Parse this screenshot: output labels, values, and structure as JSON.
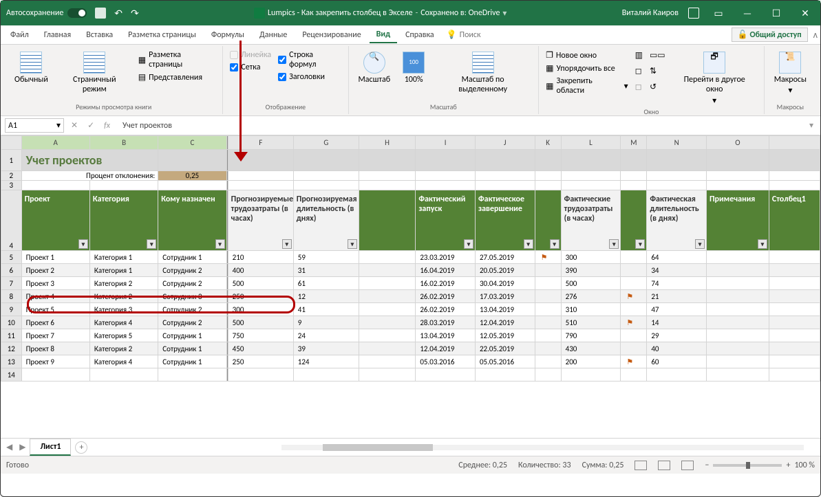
{
  "titlebar": {
    "autosave": "Автосохранение",
    "doc_title": "Lumpics - Как закрепить столбец в Экселе",
    "saved_in": "Сохранено в: OneDrive",
    "user": "Виталий Каиров"
  },
  "tabs": {
    "file": "Файл",
    "home": "Главная",
    "insert": "Вставка",
    "pagelayout": "Разметка страницы",
    "formulas": "Формулы",
    "data": "Данные",
    "review": "Рецензирование",
    "view": "Вид",
    "help": "Справка",
    "search": "Поиск",
    "share": "Общий доступ"
  },
  "ribbon": {
    "modes": {
      "normal": "Обычный",
      "page": "Страничный режим",
      "group_label": "Режимы просмотра книги",
      "pagelayout_btn": "Разметка страницы",
      "views_btn": "Представления"
    },
    "show": {
      "ruler": "Линейка",
      "formulabar": "Строка формул",
      "grid": "Сетка",
      "headings": "Заголовки",
      "group_label": "Отображение"
    },
    "zoom": {
      "zoom": "Масштаб",
      "hundred": "100%",
      "to_sel": "Масштаб по выделенному",
      "group_label": "Масштаб"
    },
    "window": {
      "new": "Новое окно",
      "arrange": "Упорядочить все",
      "freeze": "Закрепить области",
      "switch": "Перейти в другое окно",
      "group_label": "Окно"
    },
    "macros": {
      "label": "Макросы",
      "group_label": "Макросы"
    }
  },
  "formulabar": {
    "namebox": "A1",
    "fx": "fx",
    "value": "Учет проектов"
  },
  "cols": [
    "A",
    "B",
    "C",
    "F",
    "G",
    "H",
    "I",
    "J",
    "K",
    "L",
    "M",
    "N",
    "O"
  ],
  "title_row": "Учет проектов",
  "pct_label": "Процент отклонения:",
  "pct_val": "0,25",
  "headers": {
    "proj": "Проект",
    "cat": "Категория",
    "assignee": "Кому назначен",
    "est_hours": "Прогнозируемые трудозатраты (в часах)",
    "est_days": "Прогнозируемая длительность (в днях)",
    "actual_start": "Фактический запуск",
    "actual_end": "Фактическое завершение",
    "actual_hours": "Фактические трудозатраты (в часах)",
    "actual_days": "Фактическая длительность (в днях)",
    "notes": "Примечания",
    "col1": "Столбец1"
  },
  "rows": [
    {
      "proj": "Проект 1",
      "cat": "Категория 1",
      "assignee": "Сотрудник 1",
      "eh": "210",
      "ed": "59",
      "start": "23.03.2019",
      "end": "27.05.2019",
      "jflag": true,
      "ah": "300",
      "ad": "64"
    },
    {
      "proj": "Проект 2",
      "cat": "Категория 1",
      "assignee": "Сотрудник 2",
      "eh": "400",
      "ed": "31",
      "start": "16.04.2019",
      "end": "20.05.2019",
      "jflag": false,
      "ah": "390",
      "ad": "34"
    },
    {
      "proj": "Проект 3",
      "cat": "Категория 2",
      "assignee": "Сотрудник 2",
      "eh": "500",
      "ed": "61",
      "start": "16.02.2019",
      "end": "30.04.2019",
      "jflag": false,
      "ah": "500",
      "ad": "74"
    },
    {
      "proj": "Проект 4",
      "cat": "Категория 2",
      "assignee": "Сотрудник 3",
      "eh": "250",
      "ed": "12",
      "start": "26.02.2019",
      "end": "17.03.2019",
      "jflag": false,
      "ah": "276",
      "lflag": true,
      "ad": "21"
    },
    {
      "proj": "Проект 5",
      "cat": "Категория 3",
      "assignee": "Сотрудник 2",
      "eh": "300",
      "ed": "41",
      "start": "26.02.2019",
      "end": "13.04.2019",
      "jflag": false,
      "ah": "310",
      "ad": "47"
    },
    {
      "proj": "Проект 6",
      "cat": "Категория 4",
      "assignee": "Сотрудник 2",
      "eh": "500",
      "ed": "9",
      "start": "28.03.2019",
      "end": "12.04.2019",
      "jflag": false,
      "ah": "510",
      "lflag": true,
      "ad": "14"
    },
    {
      "proj": "Проект 7",
      "cat": "Категория 5",
      "assignee": "Сотрудник 1",
      "eh": "750",
      "ed": "24",
      "start": "13.04.2019",
      "end": "12.05.2019",
      "jflag": false,
      "ah": "790",
      "ad": "29"
    },
    {
      "proj": "Проект 8",
      "cat": "Категория 2",
      "assignee": "Сотрудник 1",
      "eh": "450",
      "ed": "39",
      "start": "12.04.2019",
      "end": "22.05.2019",
      "jflag": false,
      "ah": "430",
      "ad": "40"
    },
    {
      "proj": "Проект 9",
      "cat": "Категория 4",
      "assignee": "Сотрудник 1",
      "eh": "250",
      "ed": "124",
      "start": "05.03.2016",
      "end": "05.05.2016",
      "jflag": false,
      "ah": "200",
      "lflag": true,
      "ad": "60"
    }
  ],
  "sheet_tab": "Лист1",
  "status": {
    "ready": "Готово",
    "avg": "Среднее: 0,25",
    "count": "Количество: 33",
    "sum": "Сумма: 0,25",
    "zoom": "100 %"
  }
}
